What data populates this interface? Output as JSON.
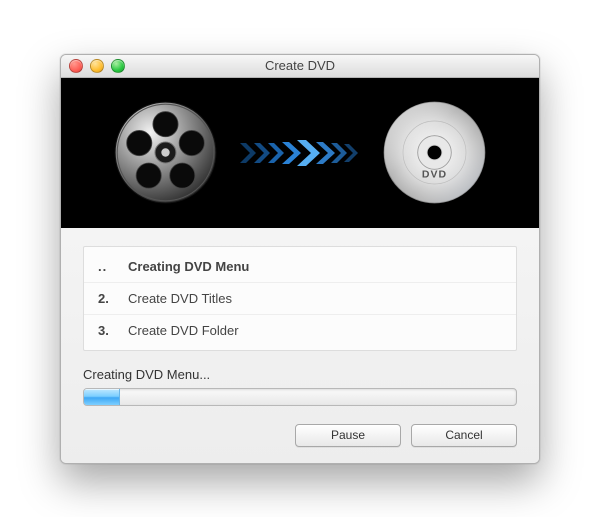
{
  "window": {
    "title": "Create DVD"
  },
  "hero": {
    "source_icon": "film-reel-icon",
    "target_icon": "dvd-disc-icon",
    "disc_label": "DVD"
  },
  "steps": [
    {
      "num": "..",
      "label": "Creating DVD Menu",
      "active": true
    },
    {
      "num": "2.",
      "label": "Create DVD Titles",
      "active": false
    },
    {
      "num": "3.",
      "label": "Create DVD Folder",
      "active": false
    }
  ],
  "status": {
    "text": "Creating DVD Menu...",
    "progress_percent": 8
  },
  "buttons": {
    "pause": "Pause",
    "cancel": "Cancel"
  }
}
